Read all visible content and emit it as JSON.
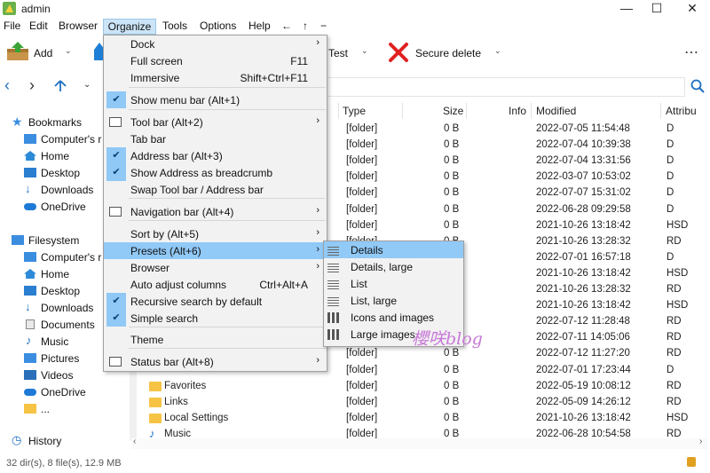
{
  "window": {
    "title": "admin",
    "minimize": "—",
    "maximize": "☐",
    "close": "✕"
  },
  "menubar": {
    "items": [
      "File",
      "Edit",
      "Browser",
      "Organize",
      "Tools",
      "Options",
      "Help",
      "←",
      "↑",
      "−"
    ]
  },
  "toolbar": {
    "add": "Add",
    "test": "Test",
    "secure_delete": "Secure delete",
    "more": "⋯"
  },
  "sidebar": {
    "bookmarks": {
      "label": "Bookmarks",
      "items": [
        "Computer's r",
        "Home",
        "Desktop",
        "Downloads",
        "OneDrive"
      ]
    },
    "filesystem": {
      "label": "Filesystem",
      "items": [
        "Computer's r",
        "Home",
        "Desktop",
        "Downloads",
        "Documents",
        "Music",
        "Pictures",
        "Videos",
        "OneDrive",
        "..."
      ]
    },
    "history": "History"
  },
  "columns": {
    "type": "Type",
    "size": "Size",
    "info": "Info",
    "modified": "Modified",
    "attributes": "Attribu"
  },
  "rows": [
    {
      "name": "",
      "type": "[folder]",
      "size": "0 B",
      "modified": "2022-07-05 11:54:48",
      "attr": "D"
    },
    {
      "name": "",
      "type": "[folder]",
      "size": "0 B",
      "modified": "2022-07-04 10:39:38",
      "attr": "D"
    },
    {
      "name": "",
      "type": "[folder]",
      "size": "0 B",
      "modified": "2022-07-04 13:31:56",
      "attr": "D"
    },
    {
      "name": "",
      "type": "[folder]",
      "size": "0 B",
      "modified": "2022-03-07 10:53:02",
      "attr": "D"
    },
    {
      "name": "",
      "type": "[folder]",
      "size": "0 B",
      "modified": "2022-07-07 15:31:02",
      "attr": "D"
    },
    {
      "name": "",
      "type": "[folder]",
      "size": "0 B",
      "modified": "2022-06-28 09:29:58",
      "attr": "D"
    },
    {
      "name": "",
      "type": "[folder]",
      "size": "0 B",
      "modified": "2021-10-26 13:18:42",
      "attr": "HSD"
    },
    {
      "name": "",
      "type": "[folder]",
      "size": "0 B",
      "modified": "2021-10-26 13:28:32",
      "attr": "RD"
    },
    {
      "name": "",
      "type": "[folder]",
      "size": "0 B",
      "modified": "2022-07-01 16:57:18",
      "attr": "D"
    },
    {
      "name": "",
      "type": "[folder]",
      "size": "0 B",
      "modified": "2021-10-26 13:18:42",
      "attr": "HSD"
    },
    {
      "name": "",
      "type": "[folder]",
      "size": "0 B",
      "modified": "2021-10-26 13:28:32",
      "attr": "RD"
    },
    {
      "name": "",
      "type": "[folder]",
      "size": "0 B",
      "modified": "2021-10-26 13:18:42",
      "attr": "HSD"
    },
    {
      "name": "",
      "type": "[folder]",
      "size": "0 B",
      "modified": "2022-07-12 11:28:48",
      "attr": "RD"
    },
    {
      "name": "",
      "type": "[folder]",
      "size": "0 B",
      "modified": "2022-07-11 14:05:06",
      "attr": "RD"
    },
    {
      "name": "",
      "type": "[folder]",
      "size": "0 B",
      "modified": "2022-07-12 11:27:20",
      "attr": "RD"
    },
    {
      "name": "",
      "type": "[folder]",
      "size": "0 B",
      "modified": "2022-07-01 17:23:44",
      "attr": "D"
    },
    {
      "name": "Favorites",
      "type": "[folder]",
      "size": "0 B",
      "modified": "2022-05-19 10:08:12",
      "attr": "RD"
    },
    {
      "name": "Links",
      "type": "[folder]",
      "size": "0 B",
      "modified": "2022-05-09 14:26:12",
      "attr": "RD"
    },
    {
      "name": "Local Settings",
      "type": "[folder]",
      "size": "0 B",
      "modified": "2021-10-26 13:18:42",
      "attr": "HSD"
    },
    {
      "name": "Music",
      "type": "[folder]",
      "size": "0 B",
      "modified": "2022-06-28 10:54:58",
      "attr": "RD"
    }
  ],
  "organize_menu": [
    {
      "label": "Dock",
      "shortcut": "",
      "arrow": "›",
      "checked": false
    },
    {
      "label": "Full screen",
      "shortcut": "F11",
      "arrow": "",
      "checked": false
    },
    {
      "label": "Immersive",
      "shortcut": "Shift+Ctrl+F11",
      "arrow": "",
      "checked": false
    },
    {
      "label": "Show menu bar (Alt+1)",
      "shortcut": "",
      "arrow": "",
      "checked": true
    },
    {
      "label": "Tool bar (Alt+2)",
      "shortcut": "",
      "arrow": "›",
      "checked": false
    },
    {
      "label": "Tab bar",
      "shortcut": "",
      "arrow": "",
      "checked": false
    },
    {
      "label": "Address bar (Alt+3)",
      "shortcut": "",
      "arrow": "",
      "checked": true
    },
    {
      "label": "Show Address as breadcrumb",
      "shortcut": "",
      "arrow": "",
      "checked": true
    },
    {
      "label": "Swap Tool bar / Address bar",
      "shortcut": "",
      "arrow": "",
      "checked": false
    },
    {
      "label": "Navigation bar (Alt+4)",
      "shortcut": "",
      "arrow": "›",
      "checked": false
    },
    {
      "label": "Sort by (Alt+5)",
      "shortcut": "",
      "arrow": "›",
      "checked": false
    },
    {
      "label": "Presets (Alt+6)",
      "shortcut": "",
      "arrow": "›",
      "checked": false
    },
    {
      "label": "Browser",
      "shortcut": "",
      "arrow": "›",
      "checked": false
    },
    {
      "label": "Auto adjust columns",
      "shortcut": "Ctrl+Alt+A",
      "arrow": "",
      "checked": false
    },
    {
      "label": "Recursive search by default",
      "shortcut": "",
      "arrow": "",
      "checked": true
    },
    {
      "label": "Simple search",
      "shortcut": "",
      "arrow": "",
      "checked": true
    },
    {
      "label": "Theme",
      "shortcut": "",
      "arrow": "",
      "checked": false
    },
    {
      "label": "Status bar (Alt+8)",
      "shortcut": "",
      "arrow": "›",
      "checked": false
    }
  ],
  "presets_menu": [
    {
      "label": "Details",
      "selected": true
    },
    {
      "label": "Details, large",
      "selected": false
    },
    {
      "label": "List",
      "selected": false
    },
    {
      "label": "List, large",
      "selected": false
    },
    {
      "label": "Icons and images",
      "selected": false
    },
    {
      "label": "Large images",
      "selected": false
    }
  ],
  "status": "32 dir(s), 8 file(s), 12.9 MB",
  "watermark": "櫻咲blog",
  "colors": {
    "accent": "#0078d7",
    "highlight": "#91c9f7",
    "folder": "#f6c344",
    "delete_red": "#e02020"
  }
}
